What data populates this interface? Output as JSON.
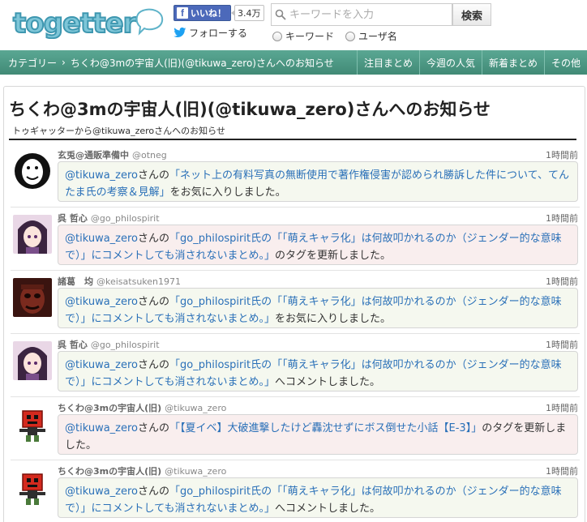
{
  "header": {
    "fb_like_label": "いいね！",
    "fb_count": "3.4万",
    "follow_label": "フォローする",
    "search_placeholder": "キーワードを入力",
    "search_button": "検索",
    "radio_keyword": "キーワード",
    "radio_user": "ユーザ名"
  },
  "nav": {
    "crumb_category": "カテゴリー",
    "crumb_sep": "›",
    "crumb_current": "ちくわ@3mの宇宙人(旧)(@tikuwa_zero)さんへのお知らせ",
    "items": [
      "注目まとめ",
      "今週の人気",
      "新着まとめ",
      "その他"
    ]
  },
  "page": {
    "title": "ちくわ@3mの宇宙人(旧)(@tikuwa_zero)さんへのお知らせ",
    "subtitle": "トゥギャッターから@tikuwa_zeroさんへのお知らせ"
  },
  "feed": [
    {
      "user_name": "玄兎@通販準備中",
      "user_id": "@otneg",
      "time": "1時間前",
      "target": "@tikuwa_zero",
      "t1": "さんの",
      "link": "「ネット上の有料写真の無断使用で著作権侵害が認められ勝訴した件について、てんたま氏の考察＆見解」",
      "t2": "をお気に入りしました。"
    },
    {
      "user_name": "呉 哲心",
      "user_id": "@go_philospirit",
      "time": "1時間前",
      "target": "@tikuwa_zero",
      "t1": "さんの",
      "link": "「go_philospirit氏の「「萌えキャラ化」は何故叩かれるのか（ジェンダー的な意味で）」にコメントしても消されないまとめ。」",
      "t2": "のタグを更新しました。"
    },
    {
      "user_name": "諸葛　均",
      "user_id": "@keisatsuken1971",
      "time": "1時間前",
      "target": "@tikuwa_zero",
      "t1": "さんの",
      "link": "「go_philospirit氏の「「萌えキャラ化」は何故叩かれるのか（ジェンダー的な意味で）」にコメントしても消されないまとめ。」",
      "t2": "をお気に入りしました。"
    },
    {
      "user_name": "呉 哲心",
      "user_id": "@go_philospirit",
      "time": "1時間前",
      "target": "@tikuwa_zero",
      "t1": "さんの",
      "link": "「go_philospirit氏の「「萌えキャラ化」は何故叩かれるのか（ジェンダー的な意味で）」にコメントしても消されないまとめ。」",
      "t2": "へコメントしました。"
    },
    {
      "user_name": "ちくわ@3mの宇宙人(旧)",
      "user_id": "@tikuwa_zero",
      "time": "1時間前",
      "target": "@tikuwa_zero",
      "t1": "さんの",
      "link": "「【夏イベ】大破進撃したけど轟沈せずにボス倒せた小話【E-3】」",
      "t2": "のタグを更新しました。"
    },
    {
      "user_name": "ちくわ@3mの宇宙人(旧)",
      "user_id": "@tikuwa_zero",
      "time": "1時間前",
      "target": "@tikuwa_zero",
      "t1": "さんの",
      "link": "「go_philospirit氏の「「萌えキャラ化」は何故叩かれるのか（ジェンダー的な意味で）」にコメントしても消されないまとめ。」",
      "t2": "へコメントしました。"
    }
  ],
  "colors": {
    "nav_green": "#4f9a85",
    "link_blue": "#2a70b8",
    "fb_blue": "#4c69ba"
  }
}
